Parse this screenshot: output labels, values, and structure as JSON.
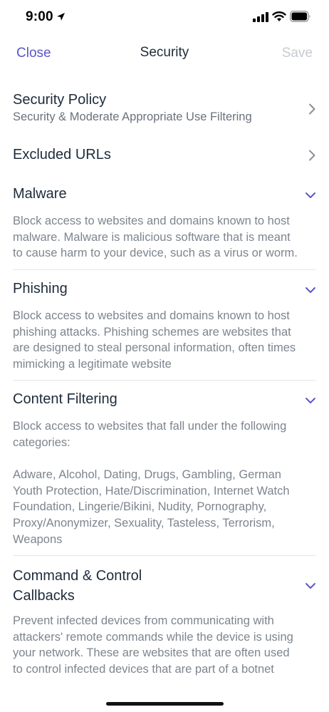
{
  "status_bar": {
    "time": "9:00",
    "icons": [
      "location-arrow-icon",
      "cellular-signal-icon",
      "wifi-icon",
      "battery-icon"
    ]
  },
  "nav": {
    "close_label": "Close",
    "title": "Security",
    "save_label": "Save"
  },
  "sections": {
    "security_policy": {
      "title": "Security Policy",
      "subtitle": "Security & Moderate Appropriate Use Filtering",
      "icon": "chevron-right-icon"
    },
    "excluded_urls": {
      "title": "Excluded URLs",
      "icon": "chevron-right-icon"
    },
    "malware": {
      "title": "Malware",
      "desc_lines": [
        "Block access to websites and domains known to host",
        "malware. Malware is malicious software that is meant",
        "to cause harm to your device, such as a virus or worm."
      ],
      "icon": "chevron-down-icon"
    },
    "phishing": {
      "title": "Phishing",
      "desc_lines": [
        "Block access to websites and domains known to host",
        "phishing attacks. Phishing schemes are websites that",
        "are designed to steal personal information, often times",
        "mimicking a legitimate website"
      ],
      "icon": "chevron-down-icon"
    },
    "content_filtering": {
      "title": "Content Filtering",
      "desc_lines": [
        "Block access to websites that fall under the following",
        "categories:"
      ],
      "category_lines": [
        "Adware, Alcohol, Dating, Drugs, Gambling, German",
        "Youth Protection, Hate/Discrimination, Internet Watch",
        "Foundation, Lingerie/Bikini, Nudity, Pornography,",
        "Proxy/Anonymizer, Sexuality, Tasteless, Terrorism,",
        "Weapons"
      ],
      "icon": "chevron-down-icon"
    },
    "command_control": {
      "title_lines": [
        "Command & Control",
        "Callbacks"
      ],
      "desc_lines": [
        "Prevent infected devices from communicating with",
        "attackers' remote commands while the device is using",
        "your network. These are websites that are often used",
        "to control infected devices that are part of a botnet"
      ],
      "icon": "chevron-down-icon"
    }
  },
  "colors": {
    "accent": "#5b57c8",
    "title_text": "#1d2b3a",
    "body_text": "#7d858f",
    "disabled": "#c7cbd1",
    "chevron_gray": "#8a9099",
    "divider": "#e3e6ea"
  }
}
